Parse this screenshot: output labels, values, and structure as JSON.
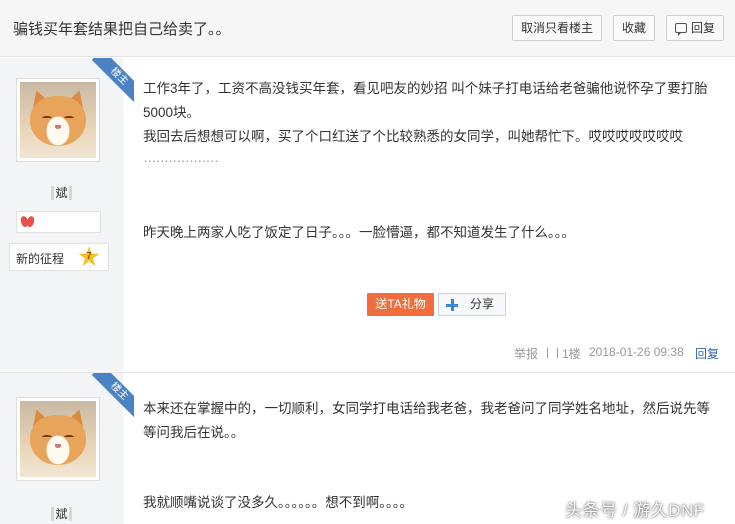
{
  "header": {
    "title": "骗钱买年套结果把自己给卖了。。",
    "only_author_label": "取消只看楼主",
    "favorite_label": "收藏",
    "reply_label": "回复"
  },
  "posts": [
    {
      "badge": "楼主",
      "username": "斌",
      "grade_label": "新的征程",
      "grade_level": "7",
      "paragraphs": [
        "工作3年了，工资不高没钱买年套，看见吧友的妙招 叫个妹子打电话给老爸骗他说怀孕了要打胎5000块。",
        "我回去后想想可以啊，买了个口红送了个比较熟悉的女同学，叫她帮忙下。哎哎哎哎哎哎哎",
        "………………",
        "昨天晚上两家人吃了饭定了日子。。。一脸懵逼，都不知道发生了什么。。。"
      ],
      "gift_label": "送TA礼物",
      "share_label": "分享",
      "report_label": "举报",
      "separator": "|",
      "floor": "1楼",
      "timestamp": "2018-01-26 09:38",
      "reply_label": "回复"
    },
    {
      "badge": "楼主",
      "username": "斌",
      "paragraphs": [
        "本来还在掌握中的，一切顺利，女同学打电话给我老爸，我老爸问了同学姓名地址，然后说先等等问我后在说。。",
        "我就顺嘴说谈了没多久。。。。。。想不到啊。。。。"
      ]
    }
  ],
  "watermark": "头条号 / 游久DNF",
  "colors": {
    "ribbon": "#4a82c4",
    "gift_button": "#f06e3b",
    "link": "#2d64b3",
    "sidebar": "#f3f4f6"
  }
}
